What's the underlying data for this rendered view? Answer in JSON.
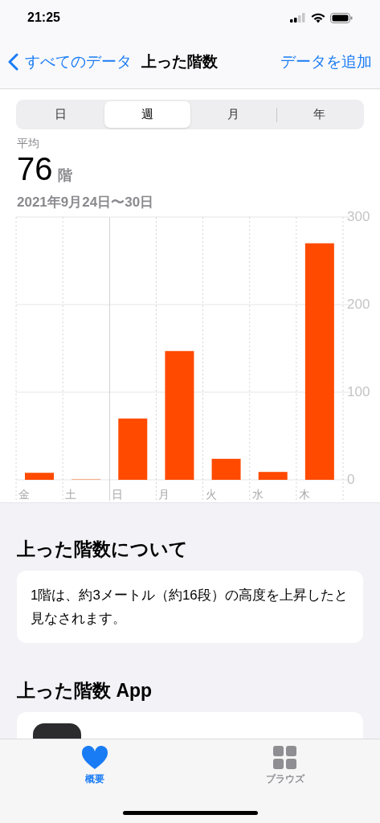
{
  "status_bar": {
    "time": "21:25"
  },
  "nav": {
    "back": "すべてのデータ",
    "title": "上った階数",
    "action": "データを追加"
  },
  "segments": [
    {
      "label": "日",
      "selected": false
    },
    {
      "label": "週",
      "selected": true
    },
    {
      "label": "月",
      "selected": false
    },
    {
      "label": "年",
      "selected": false
    }
  ],
  "summary": {
    "label": "平均",
    "value": "76",
    "unit": "階",
    "range": "2021年9月24日〜30日"
  },
  "chart_data": {
    "type": "bar",
    "categories": [
      "金",
      "土",
      "日",
      "月",
      "火",
      "水",
      "木"
    ],
    "series": [
      {
        "color": "#ff4a00",
        "values": [
          8,
          1,
          70,
          147,
          24,
          9,
          270
        ]
      }
    ],
    "ylim": [
      0,
      300
    ],
    "yticks": [
      0,
      100,
      200,
      300
    ]
  },
  "about": {
    "heading": "上った階数について",
    "text": "1階は、約3メートル（約16段）の高度を上昇したと見なされます。"
  },
  "apps": {
    "heading": "上った階数 App"
  },
  "tab_bar": [
    {
      "label": "概要",
      "kind": "heart",
      "selected": true
    },
    {
      "label": "ブラウズ",
      "kind": "grid",
      "selected": false
    }
  ]
}
